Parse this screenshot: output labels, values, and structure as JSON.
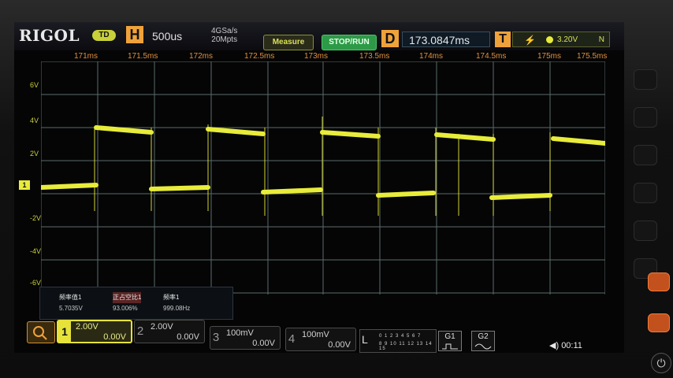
{
  "header": {
    "brand": "RIGOL",
    "mode_badge": "TD",
    "horizontal_label": "H",
    "timebase": "500us",
    "sample_rate": "4GSa/s",
    "memory_depth": "20Mpts",
    "measure_button": "Measure",
    "run_button": "STOP/RUN",
    "delay_label": "D",
    "delay_value": "173.0847ms",
    "trigger_label": "T",
    "trigger_level": "3.20V",
    "trigger_flag": "N"
  },
  "time_ticks": [
    "171ms",
    "171.5ms",
    "172ms",
    "172.5ms",
    "173ms",
    "173.5ms",
    "174ms",
    "174.5ms",
    "175ms",
    "175.5ms"
  ],
  "volt_ticks": [
    "6V",
    "4V",
    "2V",
    "-2V",
    "-4V",
    "-6V"
  ],
  "ch1_marker": "1",
  "measurements": {
    "names": [
      "频率值1",
      "正占空比1",
      "频率1"
    ],
    "values": [
      "5.7035V",
      "93.006%",
      "999.08Hz"
    ]
  },
  "channels": [
    {
      "id": "1",
      "scale": "2.00V",
      "offset": "0.00V"
    },
    {
      "id": "2",
      "scale": "2.00V",
      "offset": "0.00V"
    },
    {
      "id": "3",
      "scale": "100mV",
      "offset": "0.00V"
    },
    {
      "id": "4",
      "scale": "100mV",
      "offset": "0.00V"
    }
  ],
  "logic": {
    "label": "L",
    "row1": "0 1 2 3  4 5 6 7",
    "row2": "8 9 10 11  12 13 14 15"
  },
  "g1_label": "G1",
  "g2_label": "G2",
  "clock": "00:11",
  "colors": {
    "ch1": "#e8ec3a",
    "grid": "#5a6a6a",
    "accent": "#f0a23a",
    "run": "#2d9a48"
  }
}
